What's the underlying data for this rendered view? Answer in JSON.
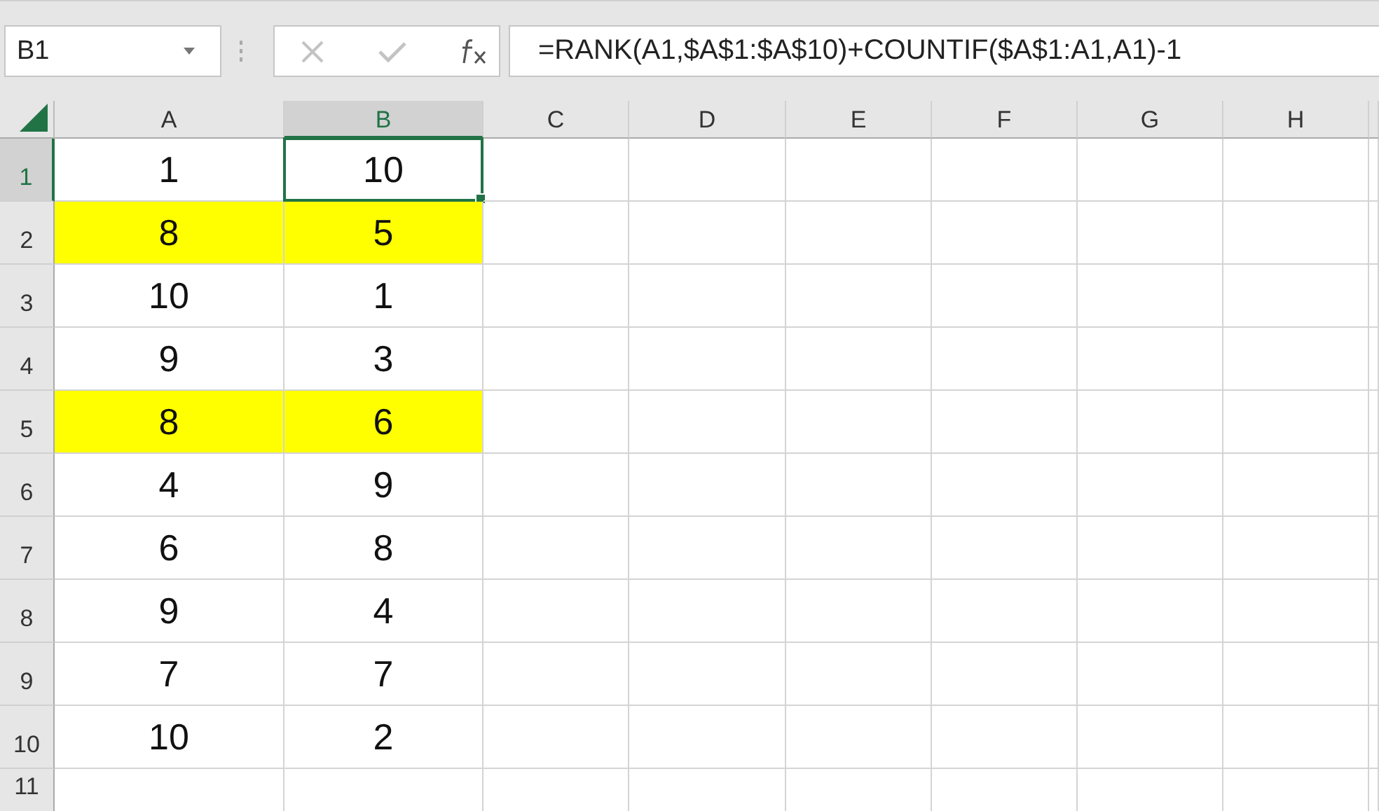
{
  "name_box": {
    "value": "B1"
  },
  "formula_bar": {
    "value": "=RANK(A1,$A$1:$A$10)+COUNTIF($A$1:A1,A1)-1"
  },
  "columns": [
    {
      "label": "A",
      "selected": false
    },
    {
      "label": "B",
      "selected": true
    },
    {
      "label": "C",
      "selected": false
    },
    {
      "label": "D",
      "selected": false
    },
    {
      "label": "E",
      "selected": false
    },
    {
      "label": "F",
      "selected": false
    },
    {
      "label": "G",
      "selected": false
    },
    {
      "label": "H",
      "selected": false
    }
  ],
  "rows": [
    {
      "header": "1",
      "selected": true,
      "cells": [
        {
          "value": "1",
          "highlighted": false,
          "selected": false
        },
        {
          "value": "10",
          "highlighted": false,
          "selected": true
        }
      ]
    },
    {
      "header": "2",
      "selected": false,
      "cells": [
        {
          "value": "8",
          "highlighted": true,
          "selected": false
        },
        {
          "value": "5",
          "highlighted": true,
          "selected": false
        }
      ]
    },
    {
      "header": "3",
      "selected": false,
      "cells": [
        {
          "value": "10",
          "highlighted": false,
          "selected": false
        },
        {
          "value": "1",
          "highlighted": false,
          "selected": false
        }
      ]
    },
    {
      "header": "4",
      "selected": false,
      "cells": [
        {
          "value": "9",
          "highlighted": false,
          "selected": false
        },
        {
          "value": "3",
          "highlighted": false,
          "selected": false
        }
      ]
    },
    {
      "header": "5",
      "selected": false,
      "cells": [
        {
          "value": "8",
          "highlighted": true,
          "selected": false
        },
        {
          "value": "6",
          "highlighted": true,
          "selected": false
        }
      ]
    },
    {
      "header": "6",
      "selected": false,
      "cells": [
        {
          "value": "4",
          "highlighted": false,
          "selected": false
        },
        {
          "value": "9",
          "highlighted": false,
          "selected": false
        }
      ]
    },
    {
      "header": "7",
      "selected": false,
      "cells": [
        {
          "value": "6",
          "highlighted": false,
          "selected": false
        },
        {
          "value": "8",
          "highlighted": false,
          "selected": false
        }
      ]
    },
    {
      "header": "8",
      "selected": false,
      "cells": [
        {
          "value": "9",
          "highlighted": false,
          "selected": false
        },
        {
          "value": "4",
          "highlighted": false,
          "selected": false
        }
      ]
    },
    {
      "header": "9",
      "selected": false,
      "cells": [
        {
          "value": "7",
          "highlighted": false,
          "selected": false
        },
        {
          "value": "7",
          "highlighted": false,
          "selected": false
        }
      ]
    },
    {
      "header": "10",
      "selected": false,
      "cells": [
        {
          "value": "10",
          "highlighted": false,
          "selected": false
        },
        {
          "value": "2",
          "highlighted": false,
          "selected": false
        }
      ]
    },
    {
      "header": "11",
      "selected": false,
      "cells": []
    }
  ]
}
